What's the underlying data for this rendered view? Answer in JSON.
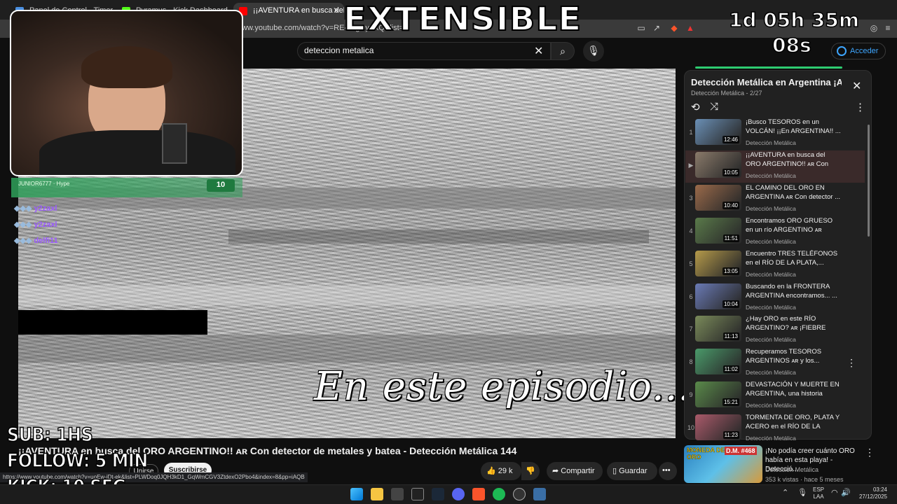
{
  "browser": {
    "tabs": [
      {
        "label": "Panel de Control - Timer"
      },
      {
        "label": "Pyramus - Kick Dashboard"
      },
      {
        "label": "¡¡AVENTURA en busca del OR"
      }
    ],
    "url": "ww.youtube.com/watch?v=RE-eegUyaXQ&list="
  },
  "youtube": {
    "search_value": "deteccion metalica",
    "signin_label": "Acceder"
  },
  "video": {
    "overlay_text": "En este episodio...",
    "title": "¡¡AVENTURA en busca del ORO ARGENTINO!! ᴀʀ Con detector de metales y batea - Detección Metálica 144",
    "join_label": "Unirse",
    "subscribe_label": "Suscribirse",
    "likes": "29 k",
    "share_label": "Compartir",
    "save_label": "Guardar",
    "more_label": "•••"
  },
  "status_url": "https://www.youtube.com/watch?v=uoEw-jDt-ek&list=PLWDoq0JQH3kD1_GqWmCGV3ZtdexO2Pbo4&index=8&pp=iAQB",
  "playlist": {
    "title": "Detección Metálica en Argentina ¡A...",
    "subtitle": "Detección Metálica - 2/27",
    "items": [
      {
        "num": "1",
        "title": "¡Busco TESOROS en un VOLCÁN! ¡¡En ARGENTINA!! ...",
        "channel": "Detección Metálica",
        "duration": "12:46",
        "color": "#6a8fb5"
      },
      {
        "num": "▶",
        "title": "¡¡AVENTURA en busca del ORO ARGENTINO!! ᴀʀ Con detector...",
        "channel": "Detección Metálica",
        "duration": "10:05",
        "color": "#8a7a6a"
      },
      {
        "num": "3",
        "title": "EL CAMINO DEL ORO EN ARGENTINA ᴀʀ Con detector ...",
        "channel": "Detección Metálica",
        "duration": "10:40",
        "color": "#9a6a4a"
      },
      {
        "num": "4",
        "title": "Encontramos ORO GRUESO en un río ARGENTINO ᴀʀ ¡Fiebre...",
        "channel": "Detección Metálica",
        "duration": "11:51",
        "color": "#5a7a4a"
      },
      {
        "num": "5",
        "title": "Encuentro TRES TELÉFONOS en el RÍO DE LA PLATA,...",
        "channel": "Detección Metálica",
        "duration": "13:05",
        "color": "#b59a4a"
      },
      {
        "num": "6",
        "title": "Buscando en la FRONTERA ARGENTINA encontramos... ...",
        "channel": "Detección Metálica",
        "duration": "10:04",
        "color": "#6a7ab5"
      },
      {
        "num": "7",
        "title": "¿Hay ORO en este RÍO ARGENTINO? ᴀʀ ¡FIEBRE DEL...",
        "channel": "Detección Metálica",
        "duration": "11:13",
        "color": "#7a8a5a"
      },
      {
        "num": "8",
        "title": "Recuperamos TESOROS ARGENTINOS ᴀʀ y los...",
        "channel": "Detección Metálica",
        "duration": "11:02",
        "color": "#4a9a6a"
      },
      {
        "num": "9",
        "title": "DEVASTACIÓN Y MUERTE EN ARGENTINA, una historia que...",
        "channel": "Detección Metálica",
        "duration": "15:21",
        "color": "#5a8a4a"
      },
      {
        "num": "10",
        "title": "TORMENTA DE ORO, PLATA Y ACERO en el RÍO DE LA PLAT...",
        "channel": "Detección Metálica",
        "duration": "11:23",
        "color": "#aa5a6a"
      }
    ]
  },
  "recommended": {
    "thumb_text": "MONEDA DE ORO",
    "thumb_badge": "D.M. #468",
    "title": "¡No podía creer cuánto ORO había en esta playa! - Detecció...",
    "channel": "Detección Metálica",
    "meta": "353 k vistas · hace 5 meses"
  },
  "overlays": {
    "banner": "EXTENSIBLE",
    "timer_line1": "1d 05h 35m",
    "timer_line2": "08s",
    "goals": [
      "SUB: 1HS",
      "FOLLOW: 5 MIN",
      "KICK: 10 SEG"
    ],
    "chat_highlight_name": "JUNIOR6777 · Hype",
    "chat_highlight_badge": "10",
    "chat_lines": [
      {
        "name": "y2zaxl",
        "color": "#9b59ff"
      },
      {
        "name": "y2zaxl",
        "color": "#9b59ff"
      },
      {
        "name": "delfi11",
        "color": "#9b59ff"
      }
    ]
  },
  "taskbar": {
    "lang_line1": "ESP",
    "lang_line2": "LAA",
    "time": "03:24",
    "date": "27/12/2025"
  }
}
